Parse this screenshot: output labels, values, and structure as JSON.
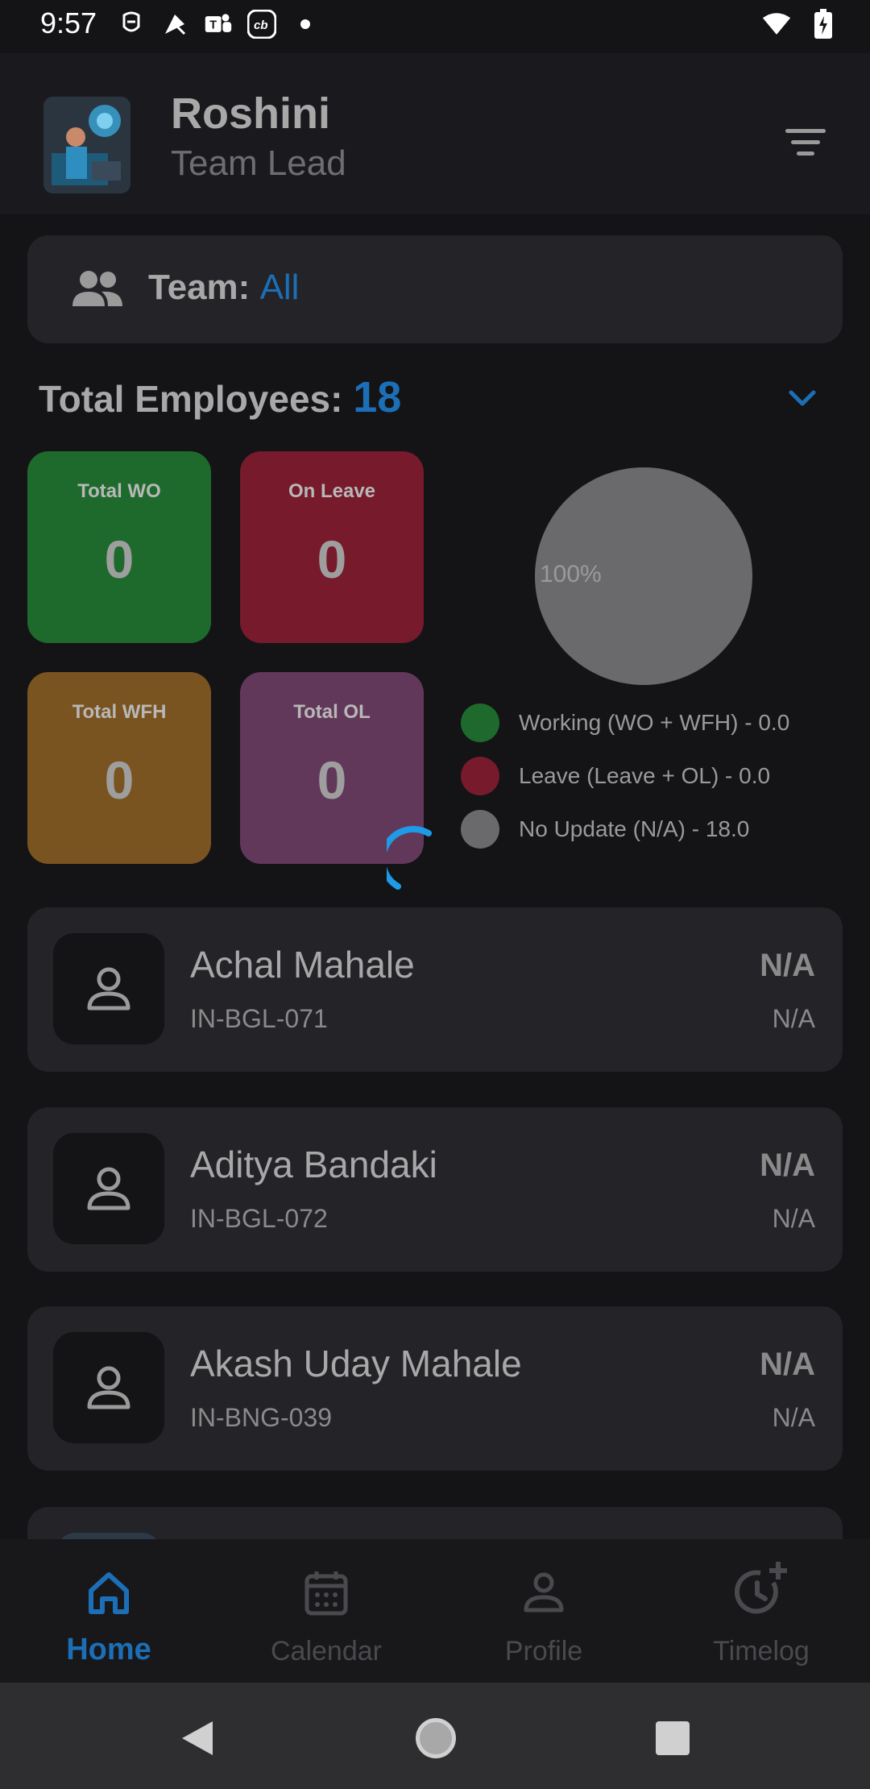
{
  "status_bar": {
    "time": "9:57",
    "left_icons": [
      "quick-share-icon",
      "kite-icon",
      "teams-icon",
      "cb-icon",
      "dot-icon"
    ],
    "right_icons": [
      "wifi-icon",
      "battery-charging-icon"
    ]
  },
  "header": {
    "name": "Roshini",
    "role": "Team Lead"
  },
  "team": {
    "label": "Team:",
    "value": "All"
  },
  "totals": {
    "label": "Total Employees:",
    "count": "18"
  },
  "tiles": [
    {
      "label": "Total WO",
      "value": "0",
      "color": "#1e6a2c"
    },
    {
      "label": "On Leave",
      "value": "0",
      "color": "#761a2c"
    },
    {
      "label": "Total WFH",
      "value": "0",
      "color": "#7a5420"
    },
    {
      "label": "Total OL",
      "value": "0",
      "color": "#62385a"
    }
  ],
  "chart_data": {
    "type": "pie",
    "slice_labels": [
      "100%"
    ],
    "values": [
      0.0,
      0.0,
      18.0
    ],
    "categories": [
      "Working (WO + WFH)",
      "Leave (Leave + OL)",
      "No Update (N/A)"
    ],
    "colors": [
      "#1e6a2c",
      "#761a2c",
      "#6a6a6c"
    ]
  },
  "legend": [
    {
      "text": "Working (WO + WFH) - 0.0",
      "color": "#1e6a2c"
    },
    {
      "text": "Leave (Leave + OL) - 0.0",
      "color": "#761a2c"
    },
    {
      "text": "No Update (N/A) - 18.0",
      "color": "#6a6a6c"
    }
  ],
  "employees": [
    {
      "name": "Achal Mahale",
      "id": "IN-BGL-071",
      "status": "N/A",
      "substatus": "N/A"
    },
    {
      "name": "Aditya Bandaki",
      "id": "IN-BGL-072",
      "status": "N/A",
      "substatus": "N/A"
    },
    {
      "name": "Akash Uday Mahale",
      "id": "IN-BNG-039",
      "status": "N/A",
      "substatus": "N/A"
    }
  ],
  "nav": [
    {
      "label": "Home",
      "icon": "home-icon",
      "active": true
    },
    {
      "label": "Calendar",
      "icon": "calendar-icon",
      "active": false
    },
    {
      "label": "Profile",
      "icon": "profile-icon",
      "active": false
    },
    {
      "label": "Timelog",
      "icon": "timelog-icon",
      "active": false
    }
  ],
  "colors": {
    "accent": "#1c6fb6",
    "spinner": "#1e9be6"
  }
}
